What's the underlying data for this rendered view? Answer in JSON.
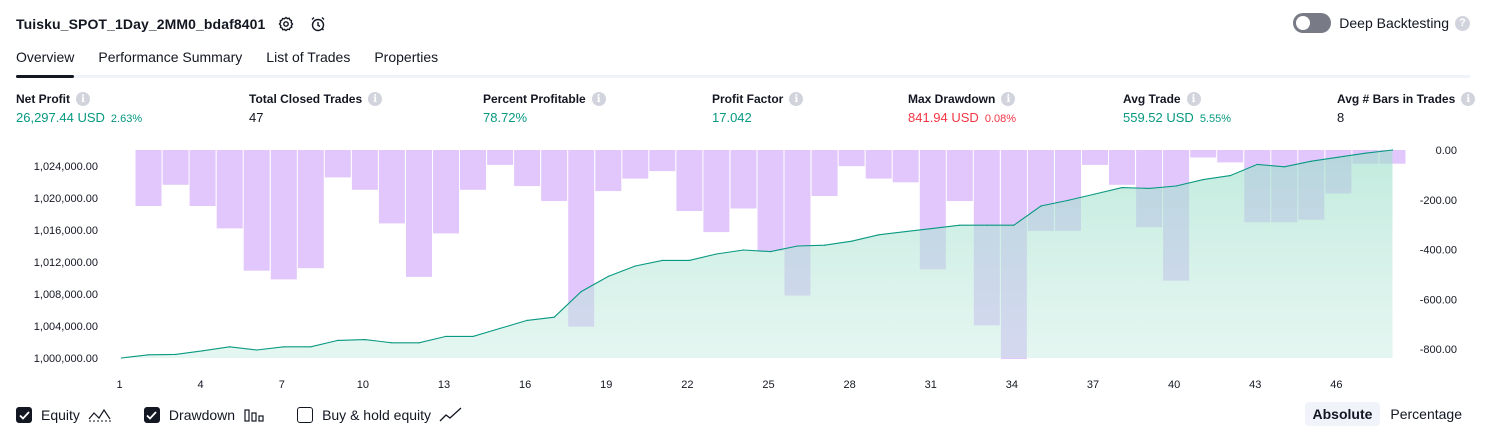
{
  "header": {
    "title": "Tuisku_SPOT_1Day_2MM0_bdaf8401",
    "deep_label": "Deep Backtesting",
    "help_icon": "?",
    "settings_icon": "gear-icon",
    "alarm_icon": "alarm-clock-icon"
  },
  "tabs": [
    {
      "label": "Overview",
      "active": true
    },
    {
      "label": "Performance Summary",
      "active": false
    },
    {
      "label": "List of Trades",
      "active": false
    },
    {
      "label": "Properties",
      "active": false
    }
  ],
  "metrics": [
    {
      "label": "Net Profit",
      "value": "26,297.44 USD",
      "sub": "2.63%",
      "color": "#089981"
    },
    {
      "label": "Total Closed Trades",
      "value": "47",
      "sub": "",
      "color": "#131722"
    },
    {
      "label": "Percent Profitable",
      "value": "78.72%",
      "sub": "",
      "color": "#089981"
    },
    {
      "label": "Profit Factor",
      "value": "17.042",
      "sub": "",
      "color": "#089981"
    },
    {
      "label": "Max Drawdown",
      "value": "841.94 USD",
      "sub": "0.08%",
      "color": "#f23645"
    },
    {
      "label": "Avg Trade",
      "value": "559.52 USD",
      "sub": "5.55%",
      "color": "#089981"
    },
    {
      "label": "Avg # Bars in Trades",
      "value": "8",
      "sub": "",
      "color": "#131722"
    }
  ],
  "info_icon": "i",
  "chart_data": {
    "type": "area",
    "x": [
      1,
      2,
      3,
      4,
      5,
      6,
      7,
      8,
      9,
      10,
      11,
      12,
      13,
      14,
      15,
      16,
      17,
      18,
      19,
      20,
      21,
      22,
      23,
      24,
      25,
      26,
      27,
      28,
      29,
      30,
      31,
      32,
      33,
      34,
      35,
      36,
      37,
      38,
      39,
      40,
      41,
      42,
      43,
      44,
      45,
      46,
      47,
      48
    ],
    "x_ticks": [
      "1",
      "4",
      "7",
      "10",
      "13",
      "16",
      "19",
      "22",
      "25",
      "28",
      "31",
      "34",
      "37",
      "40",
      "43",
      "46"
    ],
    "left_ticks": [
      "1,024,000.00",
      "1,020,000.00",
      "1,016,000.00",
      "1,012,000.00",
      "1,008,000.00",
      "1,004,000.00",
      "1,000,000.00"
    ],
    "right_ticks": [
      "0.00",
      "-200.00",
      "-400.00",
      "-600.00",
      "-800.00"
    ],
    "left_ylim": [
      1000000,
      1026000
    ],
    "right_ylim": [
      -840,
      0
    ],
    "series": [
      {
        "name": "Equity",
        "axis": "left",
        "values": [
          1000000,
          1000400,
          1000450,
          1000900,
          1001400,
          1001000,
          1001400,
          1001400,
          1002200,
          1002300,
          1001900,
          1001900,
          1002700,
          1002700,
          1003700,
          1004700,
          1005100,
          1008300,
          1010200,
          1011500,
          1012200,
          1012200,
          1013000,
          1013500,
          1013300,
          1014000,
          1014100,
          1014600,
          1015400,
          1015800,
          1016200,
          1016600,
          1016600,
          1016600,
          1019000,
          1019700,
          1020500,
          1021300,
          1021200,
          1021500,
          1022300,
          1022800,
          1024200,
          1023900,
          1024600,
          1025100,
          1025600,
          1026000
        ],
        "color": "#089981"
      },
      {
        "name": "Drawdown",
        "axis": "right",
        "values": [
          0,
          -225,
          -140,
          -225,
          -315,
          -485,
          -520,
          -475,
          -110,
          -160,
          -295,
          -510,
          -335,
          -160,
          -60,
          -145,
          -205,
          -710,
          -165,
          -115,
          -85,
          -245,
          -330,
          -235,
          -405,
          -585,
          -185,
          -65,
          -115,
          -130,
          -480,
          -205,
          -705,
          -840,
          -325,
          -325,
          -60,
          -140,
          -310,
          -525,
          -30,
          -50,
          -290,
          -290,
          -280,
          -175,
          -55,
          -55
        ],
        "color": "#c084fc"
      }
    ]
  },
  "footer": {
    "equity_label": "Equity",
    "drawdown_label": "Drawdown",
    "buyhold_label": "Buy & hold equity",
    "absolute_label": "Absolute",
    "percentage_label": "Percentage"
  }
}
